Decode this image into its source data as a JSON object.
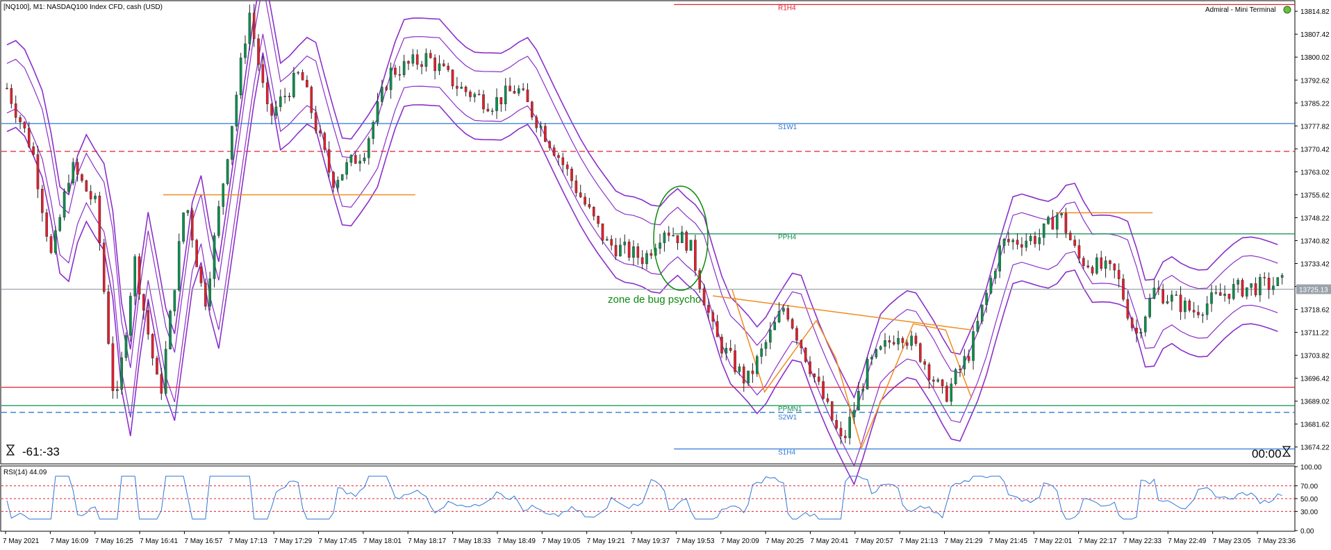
{
  "window": {
    "title": "[NQ100], M1:  NASDAQ100 Index CFD, cash (USD)",
    "broker_label": "Admiral - Mini Terminal",
    "countdown_left": "-61:-33",
    "countdown_right": "00:00"
  },
  "chart_data": {
    "type": "candlestick",
    "symbol": "NQ100",
    "timeframe": "M1",
    "price_axis": {
      "ylim": [
        13669.0,
        13818.0
      ],
      "ticks": [
        "13814.82",
        "13807.42",
        "13800.02",
        "13792.62",
        "13785.22",
        "13777.82",
        "13770.42",
        "13763.02",
        "13755.62",
        "13748.22",
        "13740.82",
        "13733.42",
        "13726.02",
        "13718.62",
        "13711.22",
        "13703.82",
        "13696.42",
        "13689.02",
        "13681.62",
        "13674.22"
      ],
      "current_price": "13725.13"
    },
    "time_axis": {
      "labels": [
        "7 May 2021",
        "7 May 16:09",
        "7 May 16:25",
        "7 May 16:41",
        "7 May 16:57",
        "7 May 17:13",
        "7 May 17:29",
        "7 May 17:45",
        "7 May 18:01",
        "7 May 18:17",
        "7 May 18:33",
        "7 May 18:49",
        "7 May 19:05",
        "7 May 19:21",
        "7 May 19:37",
        "7 May 19:53",
        "7 May 20:09",
        "7 May 20:25",
        "7 May 20:41",
        "7 May 20:57",
        "7 May 21:13",
        "7 May 21:29",
        "7 May 21:45",
        "7 May 22:01",
        "7 May 22:17",
        "7 May 22:33",
        "7 May 22:49",
        "7 May 23:05",
        "7 May 23:36"
      ]
    },
    "levels": [
      {
        "label": "R1H4",
        "price": 13817.0,
        "color": "#e0202e",
        "style": "solid",
        "start_frac": 0.52
      },
      {
        "label": "S1W1",
        "price": 13778.6,
        "color": "#2f78d6",
        "style": "solid",
        "start_frac": 0.0
      },
      {
        "label": "",
        "price": 13769.6,
        "color": "#e0202e",
        "style": "dashed",
        "start_frac": 0.0
      },
      {
        "label": "PPH4",
        "price": 13743.0,
        "color": "#0d8f4f",
        "style": "solid",
        "start_frac": 0.52
      },
      {
        "label": "",
        "price": 13725.13,
        "color": "#9aa3ab",
        "style": "solid",
        "start_frac": 0.0
      },
      {
        "label": "",
        "price": 13693.5,
        "color": "#e0202e",
        "style": "solid",
        "start_frac": 0.0
      },
      {
        "label": "PPMN1",
        "price": 13687.6,
        "color": "#0d8f4f",
        "style": "solid",
        "start_frac": 0.0
      },
      {
        "label": "S2W1",
        "price": 13685.4,
        "color": "#2f78d6",
        "style": "dashed",
        "start_frac": 0.0
      },
      {
        "label": "S1H4",
        "price": 13673.6,
        "color": "#2f78d6",
        "style": "solid",
        "start_frac": 0.52
      }
    ],
    "annotation": {
      "text": "zone de bug psycho",
      "color": "#0b8a0b"
    },
    "indicator": {
      "name": "RSI(14) 44.09",
      "ylim": [
        0,
        100
      ],
      "ticks": [
        "100.00",
        "70.00",
        "50.00",
        "30.00",
        "0.00"
      ],
      "levels": [
        70,
        50,
        30
      ]
    },
    "colors": {
      "bullish": "#0d8f4f",
      "bearish": "#e0202e",
      "bands": "#8b2fc9",
      "fib": "#f08c1e",
      "rsi": "#2f78d6"
    }
  }
}
